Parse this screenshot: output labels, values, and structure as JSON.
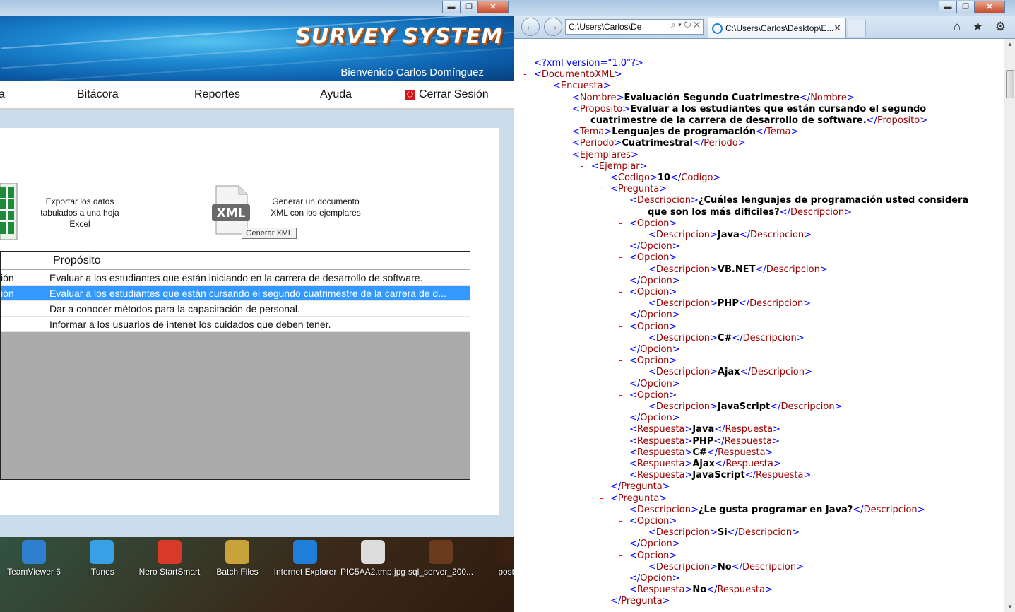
{
  "app": {
    "title": "SURVEY SYSTEM",
    "welcome": "Bienvenido Carlos Domínguez",
    "window_controls": [
      "▬",
      "❐",
      "✕"
    ],
    "menu": [
      {
        "id": "encuesta",
        "label": "a"
      },
      {
        "id": "bitacora",
        "label": "Bitácora"
      },
      {
        "id": "reportes",
        "label": "Reportes"
      },
      {
        "id": "ayuda",
        "label": "Ayuda"
      },
      {
        "id": "logout",
        "label": "Cerrar Sesión"
      }
    ],
    "actions": {
      "excel_label": "Exportar los datos tabulados a una hoja Excel",
      "xml_icon_text": "XML",
      "xml_label": "Generar un documento XML con los ejemplares",
      "xml_tooltip": "Generar XML"
    },
    "grid": {
      "header": "Propósito",
      "rows": [
        {
          "c1": "ión",
          "c2": "Evaluar a los estudiantes que están iniciando en la carrera de desarrollo de software.",
          "selected": false
        },
        {
          "c1": "ión",
          "c2": "Evaluar a los estudiantes que están cursando el segundo cuatrimestre de la carrera de d...",
          "selected": true
        },
        {
          "c1": "",
          "c2": "Dar a conocer métodos para la capacitación de personal.",
          "selected": false
        },
        {
          "c1": "",
          "c2": "Informar a los usuarios de intenet los cuidados que deben tener.",
          "selected": false
        }
      ]
    }
  },
  "desktop_icons": [
    {
      "label": "TeamViewer 6",
      "color": "#2f7fd0"
    },
    {
      "label": "iTunes",
      "color": "#3aa0e6"
    },
    {
      "label": "Nero StartSmart",
      "color": "#d83a2a"
    },
    {
      "label": "Batch Files",
      "color": "#c8a23a"
    },
    {
      "label": "Internet Explorer",
      "color": "#1f7fd8"
    },
    {
      "label": "PIC5AA2.tmp.jpg",
      "color": "#dcdcdc"
    },
    {
      "label": "sql_server_200...",
      "color": "#6a3a1e"
    },
    {
      "label": "postb",
      "color": "#3a2010"
    }
  ],
  "browser": {
    "address": "C:\\Users\\Carlos\\De",
    "address_tools": "⌕ ▾ ↻ ✕",
    "tab_title": "C:\\Users\\Carlos\\Desktop\\E...",
    "tab_close": "✕",
    "toolbar_icons": "⌂ ★ ⚙",
    "window_controls": [
      "▬",
      "❐",
      "✕"
    ]
  },
  "xml_lines": [
    {
      "indent": 0,
      "minus": false,
      "html": "<span class='p'>&lt;?xml version=\"1.0\"?&gt;</span>"
    },
    {
      "indent": 0,
      "minus": true,
      "html": "<span class='p'>&lt;</span><span class='t'>DocumentoXML</span><span class='p'>&gt;</span>"
    },
    {
      "indent": 1,
      "minus": true,
      "html": "<span class='p'>&lt;</span><span class='t'>Encuesta</span><span class='p'>&gt;</span>"
    },
    {
      "indent": 2,
      "minus": false,
      "html": "<span class='p'>&lt;</span><span class='t'>Nombre</span><span class='p'>&gt;</span><span class='b'>Evaluación Segundo Cuatrimestre</span><span class='p'>&lt;/</span><span class='t'>Nombre</span><span class='p'>&gt;</span>"
    },
    {
      "indent": 2,
      "minus": false,
      "html": "<span class='p'>&lt;</span><span class='t'>Proposito</span><span class='p'>&gt;</span><span class='b'>Evaluar a los estudiantes que están cursando el segundo</span>"
    },
    {
      "indent": 2,
      "minus": false,
      "cont": true,
      "html": "<span class='b'>cuatrimestre de la carrera de desarrollo de software.</span><span class='p'>&lt;/</span><span class='t'>Proposito</span><span class='p'>&gt;</span>"
    },
    {
      "indent": 2,
      "minus": false,
      "html": "<span class='p'>&lt;</span><span class='t'>Tema</span><span class='p'>&gt;</span><span class='b'>Lenguajes de programación</span><span class='p'>&lt;/</span><span class='t'>Tema</span><span class='p'>&gt;</span>"
    },
    {
      "indent": 2,
      "minus": false,
      "html": "<span class='p'>&lt;</span><span class='t'>Periodo</span><span class='p'>&gt;</span><span class='b'>Cuatrimestral</span><span class='p'>&lt;/</span><span class='t'>Periodo</span><span class='p'>&gt;</span>"
    },
    {
      "indent": 2,
      "minus": true,
      "html": "<span class='p'>&lt;</span><span class='t'>Ejemplares</span><span class='p'>&gt;</span>"
    },
    {
      "indent": 3,
      "minus": true,
      "html": "<span class='p'>&lt;</span><span class='t'>Ejemplar</span><span class='p'>&gt;</span>"
    },
    {
      "indent": 4,
      "minus": false,
      "html": "<span class='p'>&lt;</span><span class='t'>Codigo</span><span class='p'>&gt;</span><span class='b'>10</span><span class='p'>&lt;/</span><span class='t'>Codigo</span><span class='p'>&gt;</span>"
    },
    {
      "indent": 4,
      "minus": true,
      "html": "<span class='p'>&lt;</span><span class='t'>Pregunta</span><span class='p'>&gt;</span>"
    },
    {
      "indent": 5,
      "minus": false,
      "html": "<span class='p'>&lt;</span><span class='t'>Descripcion</span><span class='p'>&gt;</span><span class='b'>¿Cuáles lenguajes de programación usted considera</span>"
    },
    {
      "indent": 5,
      "minus": false,
      "cont": true,
      "html": "<span class='b'>que son los más dificiles?</span><span class='p'>&lt;/</span><span class='t'>Descripcion</span><span class='p'>&gt;</span>"
    },
    {
      "indent": 5,
      "minus": true,
      "html": "<span class='p'>&lt;</span><span class='t'>Opcion</span><span class='p'>&gt;</span>"
    },
    {
      "indent": 6,
      "minus": false,
      "html": "<span class='p'>&lt;</span><span class='t'>Descripcion</span><span class='p'>&gt;</span><span class='b'>Java</span><span class='p'>&lt;/</span><span class='t'>Descripcion</span><span class='p'>&gt;</span>"
    },
    {
      "indent": 5,
      "minus": false,
      "html": "<span class='p'>&lt;/</span><span class='t'>Opcion</span><span class='p'>&gt;</span>"
    },
    {
      "indent": 5,
      "minus": true,
      "html": "<span class='p'>&lt;</span><span class='t'>Opcion</span><span class='p'>&gt;</span>"
    },
    {
      "indent": 6,
      "minus": false,
      "html": "<span class='p'>&lt;</span><span class='t'>Descripcion</span><span class='p'>&gt;</span><span class='b'>VB.NET</span><span class='p'>&lt;/</span><span class='t'>Descripcion</span><span class='p'>&gt;</span>"
    },
    {
      "indent": 5,
      "minus": false,
      "html": "<span class='p'>&lt;/</span><span class='t'>Opcion</span><span class='p'>&gt;</span>"
    },
    {
      "indent": 5,
      "minus": true,
      "html": "<span class='p'>&lt;</span><span class='t'>Opcion</span><span class='p'>&gt;</span>"
    },
    {
      "indent": 6,
      "minus": false,
      "html": "<span class='p'>&lt;</span><span class='t'>Descripcion</span><span class='p'>&gt;</span><span class='b'>PHP</span><span class='p'>&lt;/</span><span class='t'>Descripcion</span><span class='p'>&gt;</span>"
    },
    {
      "indent": 5,
      "minus": false,
      "html": "<span class='p'>&lt;/</span><span class='t'>Opcion</span><span class='p'>&gt;</span>"
    },
    {
      "indent": 5,
      "minus": true,
      "html": "<span class='p'>&lt;</span><span class='t'>Opcion</span><span class='p'>&gt;</span>"
    },
    {
      "indent": 6,
      "minus": false,
      "html": "<span class='p'>&lt;</span><span class='t'>Descripcion</span><span class='p'>&gt;</span><span class='b'>C#</span><span class='p'>&lt;/</span><span class='t'>Descripcion</span><span class='p'>&gt;</span>"
    },
    {
      "indent": 5,
      "minus": false,
      "html": "<span class='p'>&lt;/</span><span class='t'>Opcion</span><span class='p'>&gt;</span>"
    },
    {
      "indent": 5,
      "minus": true,
      "html": "<span class='p'>&lt;</span><span class='t'>Opcion</span><span class='p'>&gt;</span>"
    },
    {
      "indent": 6,
      "minus": false,
      "html": "<span class='p'>&lt;</span><span class='t'>Descripcion</span><span class='p'>&gt;</span><span class='b'>Ajax</span><span class='p'>&lt;/</span><span class='t'>Descripcion</span><span class='p'>&gt;</span>"
    },
    {
      "indent": 5,
      "minus": false,
      "html": "<span class='p'>&lt;/</span><span class='t'>Opcion</span><span class='p'>&gt;</span>"
    },
    {
      "indent": 5,
      "minus": true,
      "html": "<span class='p'>&lt;</span><span class='t'>Opcion</span><span class='p'>&gt;</span>"
    },
    {
      "indent": 6,
      "minus": false,
      "html": "<span class='p'>&lt;</span><span class='t'>Descripcion</span><span class='p'>&gt;</span><span class='b'>JavaScript</span><span class='p'>&lt;/</span><span class='t'>Descripcion</span><span class='p'>&gt;</span>"
    },
    {
      "indent": 5,
      "minus": false,
      "html": "<span class='p'>&lt;/</span><span class='t'>Opcion</span><span class='p'>&gt;</span>"
    },
    {
      "indent": 5,
      "minus": false,
      "html": "<span class='p'>&lt;</span><span class='t'>Respuesta</span><span class='p'>&gt;</span><span class='b'>Java</span><span class='p'>&lt;/</span><span class='t'>Respuesta</span><span class='p'>&gt;</span>"
    },
    {
      "indent": 5,
      "minus": false,
      "html": "<span class='p'>&lt;</span><span class='t'>Respuesta</span><span class='p'>&gt;</span><span class='b'>PHP</span><span class='p'>&lt;/</span><span class='t'>Respuesta</span><span class='p'>&gt;</span>"
    },
    {
      "indent": 5,
      "minus": false,
      "html": "<span class='p'>&lt;</span><span class='t'>Respuesta</span><span class='p'>&gt;</span><span class='b'>C#</span><span class='p'>&lt;/</span><span class='t'>Respuesta</span><span class='p'>&gt;</span>"
    },
    {
      "indent": 5,
      "minus": false,
      "html": "<span class='p'>&lt;</span><span class='t'>Respuesta</span><span class='p'>&gt;</span><span class='b'>Ajax</span><span class='p'>&lt;/</span><span class='t'>Respuesta</span><span class='p'>&gt;</span>"
    },
    {
      "indent": 5,
      "minus": false,
      "html": "<span class='p'>&lt;</span><span class='t'>Respuesta</span><span class='p'>&gt;</span><span class='b'>JavaScript</span><span class='p'>&lt;/</span><span class='t'>Respuesta</span><span class='p'>&gt;</span>"
    },
    {
      "indent": 4,
      "minus": false,
      "html": "<span class='p'>&lt;/</span><span class='t'>Pregunta</span><span class='p'>&gt;</span>"
    },
    {
      "indent": 4,
      "minus": true,
      "html": "<span class='p'>&lt;</span><span class='t'>Pregunta</span><span class='p'>&gt;</span>"
    },
    {
      "indent": 5,
      "minus": false,
      "html": "<span class='p'>&lt;</span><span class='t'>Descripcion</span><span class='p'>&gt;</span><span class='b'>¿Le gusta programar en Java?</span><span class='p'>&lt;/</span><span class='t'>Descripcion</span><span class='p'>&gt;</span>"
    },
    {
      "indent": 5,
      "minus": true,
      "html": "<span class='p'>&lt;</span><span class='t'>Opcion</span><span class='p'>&gt;</span>"
    },
    {
      "indent": 6,
      "minus": false,
      "html": "<span class='p'>&lt;</span><span class='t'>Descripcion</span><span class='p'>&gt;</span><span class='b'>Si</span><span class='p'>&lt;/</span><span class='t'>Descripcion</span><span class='p'>&gt;</span>"
    },
    {
      "indent": 5,
      "minus": false,
      "html": "<span class='p'>&lt;/</span><span class='t'>Opcion</span><span class='p'>&gt;</span>"
    },
    {
      "indent": 5,
      "minus": true,
      "html": "<span class='p'>&lt;</span><span class='t'>Opcion</span><span class='p'>&gt;</span>"
    },
    {
      "indent": 6,
      "minus": false,
      "html": "<span class='p'>&lt;</span><span class='t'>Descripcion</span><span class='p'>&gt;</span><span class='b'>No</span><span class='p'>&lt;/</span><span class='t'>Descripcion</span><span class='p'>&gt;</span>"
    },
    {
      "indent": 5,
      "minus": false,
      "html": "<span class='p'>&lt;/</span><span class='t'>Opcion</span><span class='p'>&gt;</span>"
    },
    {
      "indent": 5,
      "minus": false,
      "html": "<span class='p'>&lt;</span><span class='t'>Respuesta</span><span class='p'>&gt;</span><span class='b'>No</span><span class='p'>&lt;/</span><span class='t'>Respuesta</span><span class='p'>&gt;</span>"
    },
    {
      "indent": 4,
      "minus": false,
      "html": "<span class='p'>&lt;/</span><span class='t'>Pregunta</span><span class='p'>&gt;</span>"
    }
  ]
}
